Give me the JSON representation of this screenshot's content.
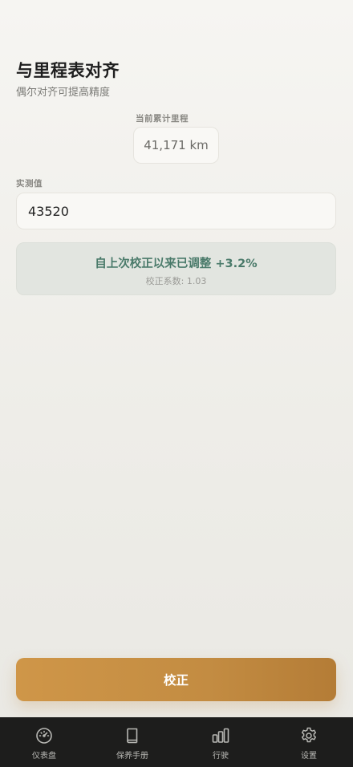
{
  "header": {
    "title": "与里程表对齐",
    "subtitle": "偶尔对齐可提高精度"
  },
  "current": {
    "label": "当前累计里程",
    "value": "41,171 km"
  },
  "measured": {
    "label": "实测值",
    "value": "43520"
  },
  "info": {
    "main": "自上次校正以来已调整 +3.2%",
    "sub": "校正系数: 1.03"
  },
  "action": {
    "calibrate_label": "校正"
  },
  "tabbar": {
    "items": [
      {
        "label": "仪表盘",
        "icon": "gauge-icon"
      },
      {
        "label": "保养手册",
        "icon": "book-icon"
      },
      {
        "label": "行驶",
        "icon": "bar-chart-icon"
      },
      {
        "label": "设置",
        "icon": "gear-icon"
      }
    ]
  },
  "colors": {
    "accent": "#c38c42",
    "info_text": "#4a7a6a",
    "tabbar_bg": "#1d1d1c"
  }
}
